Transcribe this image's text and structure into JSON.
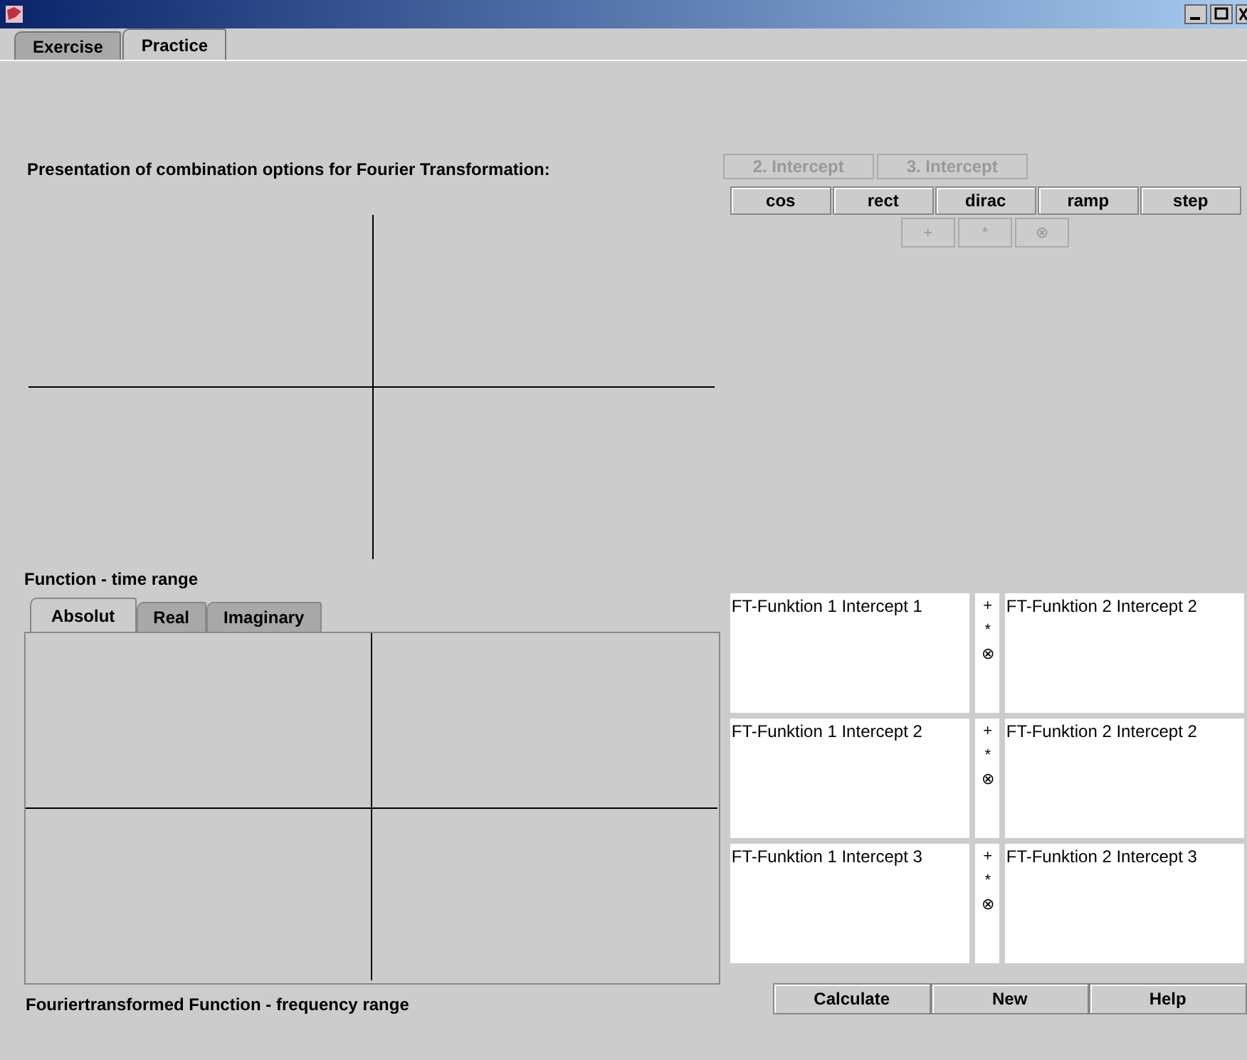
{
  "tabs": [
    {
      "label": "Exercise",
      "selected": false
    },
    {
      "label": "Practice",
      "selected": true
    }
  ],
  "presentation_label": "Presentation of combination options for Fourier Transformation:",
  "intercept_buttons": [
    {
      "label": "2. Intercept",
      "disabled": true
    },
    {
      "label": "3. Intercept",
      "disabled": true
    }
  ],
  "function_buttons": [
    "cos",
    "rect",
    "dirac",
    "ramp",
    "step"
  ],
  "operator_buttons": [
    {
      "label": "+",
      "disabled": true
    },
    {
      "label": "*",
      "disabled": true
    },
    {
      "label": "⊗",
      "disabled": true
    }
  ],
  "time_label": "Function - time range",
  "view_tabs": [
    {
      "label": "Absolut",
      "selected": true
    },
    {
      "label": "Real",
      "selected": false
    },
    {
      "label": "Imaginary",
      "selected": false
    }
  ],
  "combinations": [
    {
      "left": "FT-Funktion 1 Intercept 1",
      "operators": [
        "+",
        "*",
        "⊗"
      ],
      "right": "FT-Funktion 2 Intercept 2"
    },
    {
      "left": "FT-Funktion 1 Intercept 2",
      "operators": [
        "+",
        "*",
        "⊗"
      ],
      "right": "FT-Funktion 2 Intercept 2"
    },
    {
      "left": "FT-Funktion 1 Intercept 3",
      "operators": [
        "+",
        "*",
        "⊗"
      ],
      "right": "FT-Funktion 2 Intercept 3"
    }
  ],
  "frequency_label": "Fouriertransformed Function - frequency range",
  "actions": [
    "Calculate",
    "New",
    "Help"
  ]
}
